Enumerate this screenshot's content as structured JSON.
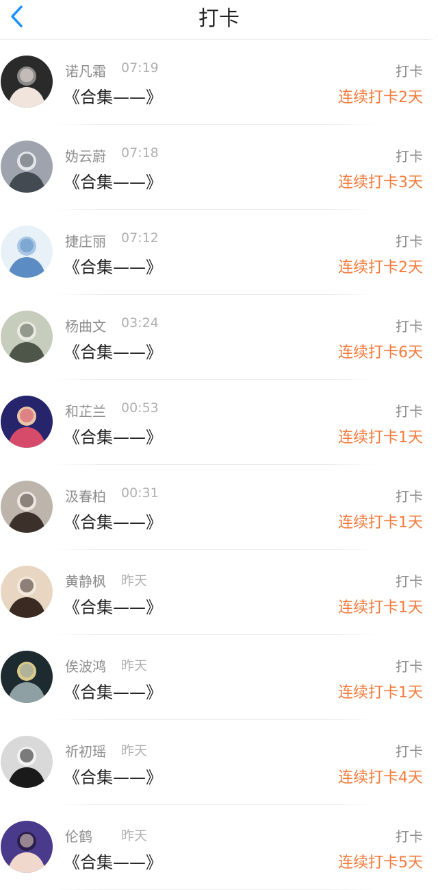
{
  "header": {
    "title": "打卡",
    "back_icon": "chevron-left-icon",
    "accent": "#1e90ff"
  },
  "colors": {
    "streak": "#f47a3a",
    "meta": "#8e8e8e"
  },
  "entries": [
    {
      "name": "诺凡霜",
      "time": "07:19",
      "content": "《合集——》",
      "label": "打卡",
      "streak": "连续打卡2天",
      "avatar": {
        "bg": "#2a2a2a",
        "fg": "#f1e4dc",
        "accent": "#8a8a8a"
      }
    },
    {
      "name": "妫云蔚",
      "time": "07:18",
      "content": "《合集——》",
      "label": "打卡",
      "streak": "连续打卡3天",
      "avatar": {
        "bg": "#9ea3ad",
        "fg": "#444a52",
        "accent": "#e3e6ea"
      }
    },
    {
      "name": "捷庄丽",
      "time": "07:12",
      "content": "《合集——》",
      "label": "打卡",
      "streak": "连续打卡2天",
      "avatar": {
        "bg": "#e9f1f8",
        "fg": "#5b8cc4",
        "accent": "#a9c7e4"
      }
    },
    {
      "name": "杨曲文",
      "time": "03:24",
      "content": "《合集——》",
      "label": "打卡",
      "streak": "连续打卡6天",
      "avatar": {
        "bg": "#c7cdbd",
        "fg": "#4e5649",
        "accent": "#e8ebe2"
      }
    },
    {
      "name": "和芷兰",
      "time": "00:53",
      "content": "《合集——》",
      "label": "打卡",
      "streak": "连续打卡1天",
      "avatar": {
        "bg": "#26246b",
        "fg": "#d64a6a",
        "accent": "#e8c5a8"
      }
    },
    {
      "name": "汲春柏",
      "time": "00:31",
      "content": "《合集——》",
      "label": "打卡",
      "streak": "连续打卡1天",
      "avatar": {
        "bg": "#bdb4ac",
        "fg": "#3b302a",
        "accent": "#efe7df"
      }
    },
    {
      "name": "黄静枫",
      "time": "昨天",
      "content": "《合集——》",
      "label": "打卡",
      "streak": "连续打卡1天",
      "avatar": {
        "bg": "#e8d6c2",
        "fg": "#3a2a22",
        "accent": "#f3e8dc"
      }
    },
    {
      "name": "俟波鸿",
      "time": "昨天",
      "content": "《合集——》",
      "label": "打卡",
      "streak": "连续打卡1天",
      "avatar": {
        "bg": "#1d2a2f",
        "fg": "#8ea0a3",
        "accent": "#d9c98a"
      }
    },
    {
      "name": "祈初瑶",
      "time": "昨天",
      "content": "《合集——》",
      "label": "打卡",
      "streak": "连续打卡4天",
      "avatar": {
        "bg": "#d9d9d9",
        "fg": "#1a1a1a",
        "accent": "#f2f2f2"
      }
    },
    {
      "name": "伦鹤",
      "time": "昨天",
      "content": "《合集——》",
      "label": "打卡",
      "streak": "连续打卡5天",
      "avatar": {
        "bg": "#4a3a8c",
        "fg": "#f0d9cc",
        "accent": "#2a1f4a"
      }
    }
  ]
}
